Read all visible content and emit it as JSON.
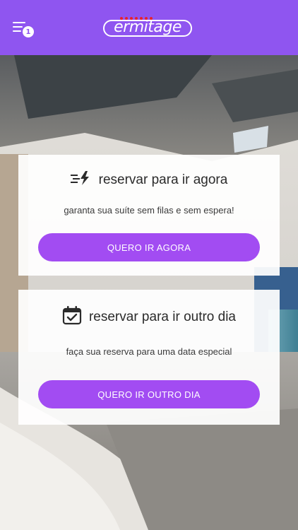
{
  "header": {
    "notification_count": "1",
    "logo_text": "ermitage",
    "background_color": "#8f55f0"
  },
  "card_now": {
    "icon": "fast-lightning-icon",
    "title": "reservar para ir agora",
    "subtitle": "garanta sua suíte sem filas e sem espera!",
    "button_label": "QUERO IR AGORA"
  },
  "card_other_day": {
    "icon": "calendar-check-icon",
    "title": "reservar para ir outro dia",
    "subtitle": "faça sua reserva para uma data especial",
    "button_label": "QUERO IR OUTRO DIA"
  },
  "colors": {
    "accent": "#a24cf2",
    "header": "#8f55f0",
    "logo_dots": "#e8232b"
  }
}
